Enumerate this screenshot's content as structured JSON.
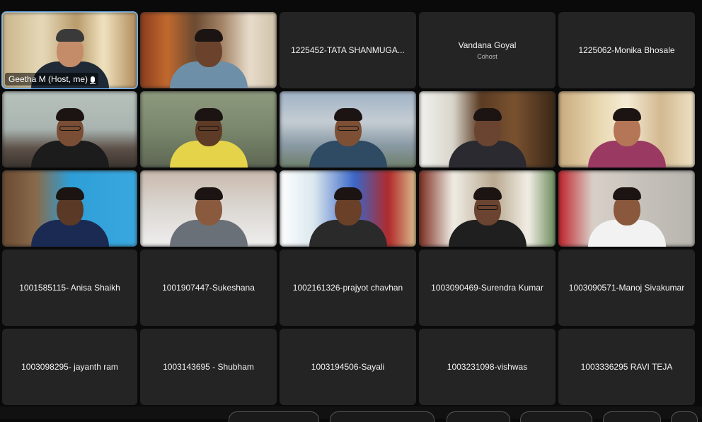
{
  "self_tile": {
    "name": "Geetha M (Host, me)"
  },
  "name_tiles": [
    {
      "name": "1225452-TATA SHANMUGA...",
      "role": ""
    },
    {
      "name": "Vandana Goyal",
      "role": "Cohost"
    },
    {
      "name": "1225062-Monika Bhosale",
      "role": ""
    }
  ],
  "bottom_tiles": [
    {
      "name": "1001585115- Anisa Shaikh"
    },
    {
      "name": "1001907447-Sukeshana"
    },
    {
      "name": "1002161326-prajyot chavhan"
    },
    {
      "name": "1003090469-Surendra Kumar"
    },
    {
      "name": "1003090571-Manoj Sivakumar"
    },
    {
      "name": "1003098295- jayanth ram"
    },
    {
      "name": "1003143695 - Shubham"
    },
    {
      "name": "1003194506-Sayali"
    },
    {
      "name": "1003231098-vishwas"
    },
    {
      "name": "1003336295 RAVI TEJA"
    }
  ],
  "colors": {
    "active_border": "#6ab0f3",
    "tile_bg": "#242424",
    "page_bg": "#0a0a0a"
  }
}
